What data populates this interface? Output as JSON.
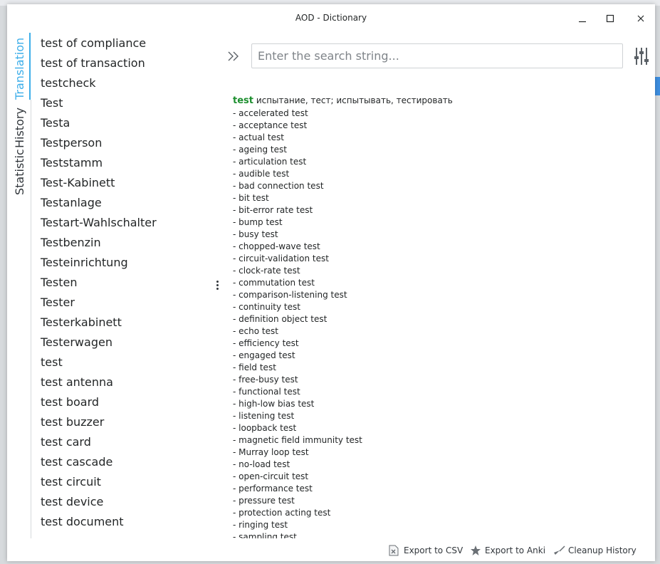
{
  "window": {
    "title": "AOD - Dictionary",
    "controls": [
      "minimize",
      "maximize",
      "close"
    ]
  },
  "tabs": [
    {
      "label": "Translation",
      "active": true
    },
    {
      "label": "History",
      "active": false
    },
    {
      "label": "Statistic",
      "active": false
    }
  ],
  "wordlist": [
    "test of compliance",
    "test of transaction",
    "testcheck",
    "Test",
    "Testa",
    "Testperson",
    "Teststamm",
    "Test-Kabinett",
    "Testanlage",
    "Testart-Wahlschalter",
    "Testbenzin",
    "Testeinrichtung",
    "Testen",
    "Tester",
    "Testerkabinett",
    "Testerwagen",
    "test",
    "test antenna",
    "test board",
    "test buzzer",
    "test card",
    "test cascade",
    "test circuit",
    "test device",
    "test document"
  ],
  "search": {
    "placeholder": "Enter the search string...",
    "value": ""
  },
  "entry": {
    "word": "test",
    "translation": "испытание, тест; испытывать, тестировать",
    "phrases": [
      "- accelerated test",
      "- acceptance test",
      "- actual test",
      "- ageing test",
      "- articulation test",
      "- audible test",
      "- bad connection test",
      "- bit test",
      "- bit-error rate test",
      "- bump test",
      "- busy test",
      "- chopped-wave test",
      "- circuit-validation test",
      "- clock-rate test",
      "- commutation test",
      "- comparison-listening test",
      "- continuity test",
      "- definition object test",
      "- echo test",
      "- efficiency test",
      "- engaged test",
      "- field test",
      "- free-busy test",
      "- functional test",
      "- high-low bias test",
      "- listening test",
      "- loopback test",
      "- magnetic field immunity test",
      "- Murray loop test",
      "- no-load test",
      "- open-circuit test",
      "- performance test",
      "- pressure test",
      "- protection acting test",
      "- ringing test",
      "- sampling test"
    ]
  },
  "toolbar": {
    "export_csv": "Export to CSV",
    "export_anki": "Export to Anki",
    "cleanup_history": "Cleanup History"
  },
  "colors": {
    "accent": "#3daee9",
    "headword": "#1d8f2f",
    "text": "#232627"
  }
}
